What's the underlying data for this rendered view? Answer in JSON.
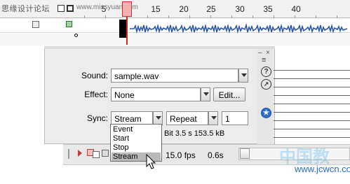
{
  "timeline": {
    "watermark_text": "思缘设计论坛",
    "site_text": "www.missyuan.com",
    "ruler_numbers": [
      "5",
      "10",
      "15",
      "20",
      "25",
      "30",
      "35",
      "40"
    ],
    "frame_marker": "o"
  },
  "properties": {
    "sound_label": "Sound:",
    "sound_value": "sample.wav",
    "effect_label": "Effect:",
    "effect_value": "None",
    "edit_button": "Edit...",
    "sync_label": "Sync:",
    "sync_value": "Stream",
    "repeat_value": "Repeat",
    "repeat_count": "1",
    "sound_info": "Bit 3.5 s 153.5 kB",
    "help_icon_glyph": "?",
    "accessibility_icon_glyph": "★"
  },
  "sync_menu": {
    "items": [
      "Event",
      "Start",
      "Stop",
      "Stream"
    ],
    "selected": "Stream"
  },
  "status_bar": {
    "frame_rate": "15.0 fps",
    "elapsed_time": "0.6s"
  },
  "watermark": {
    "site": "www.jcwcn.com"
  },
  "colors": {
    "playhead": "#cc2a2a",
    "waveform": "#2d57a6"
  }
}
